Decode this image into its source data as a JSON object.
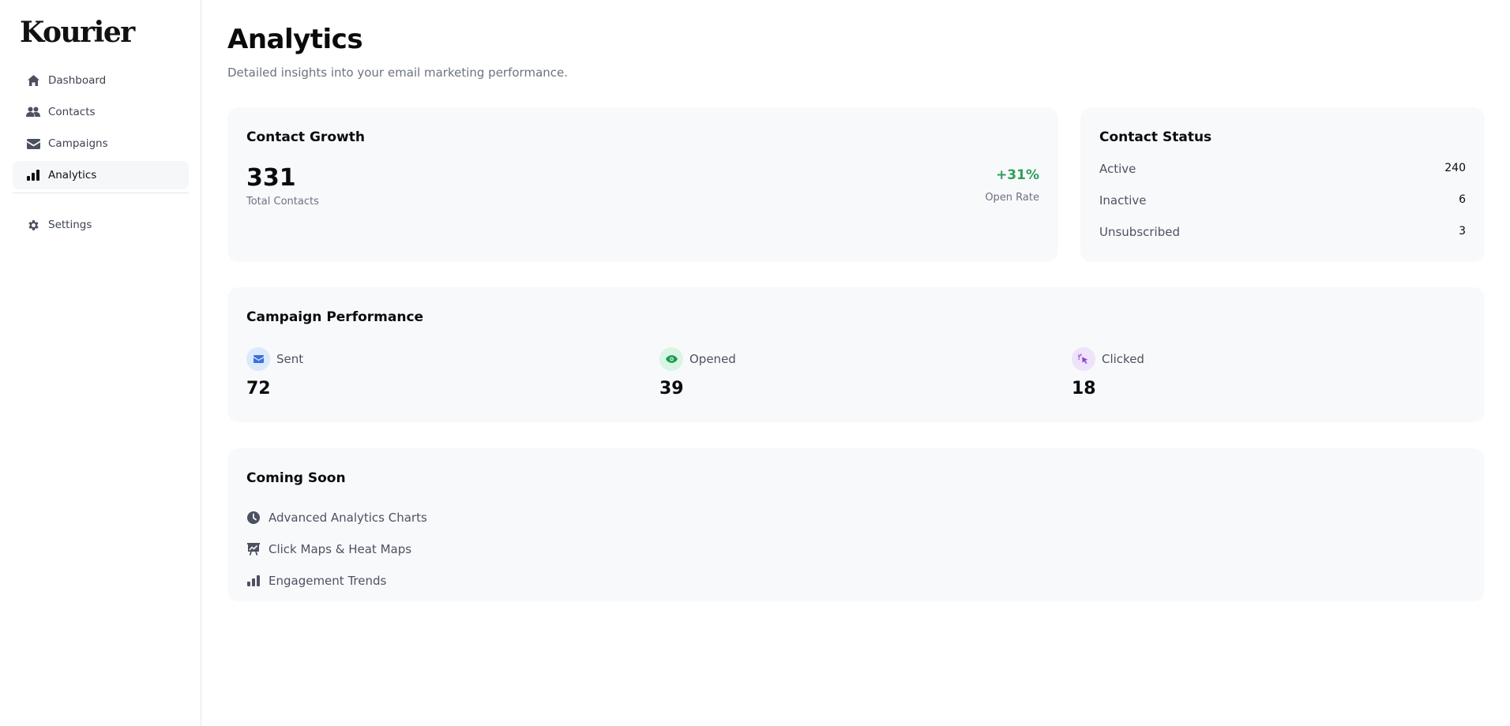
{
  "app": {
    "logo": "Kourier"
  },
  "sidebar": {
    "items": [
      {
        "label": "Dashboard",
        "icon": "home-icon",
        "active": false
      },
      {
        "label": "Contacts",
        "icon": "users-icon",
        "active": false
      },
      {
        "label": "Campaigns",
        "icon": "envelope-icon",
        "active": false
      },
      {
        "label": "Analytics",
        "icon": "bar-chart-icon",
        "active": true
      }
    ],
    "secondary": [
      {
        "label": "Settings",
        "icon": "gear-icon"
      }
    ]
  },
  "header": {
    "title": "Analytics",
    "subtitle": "Detailed insights into your email marketing performance."
  },
  "contact_growth": {
    "title": "Contact Growth",
    "total": "331",
    "total_label": "Total Contacts",
    "rate": "+31%",
    "rate_label": "Open Rate",
    "rate_color": "#2f9e5a"
  },
  "contact_status": {
    "title": "Contact Status",
    "rows": [
      {
        "label": "Active",
        "value": "240"
      },
      {
        "label": "Inactive",
        "value": "6"
      },
      {
        "label": "Unsubscribed",
        "value": "3"
      }
    ]
  },
  "campaign_performance": {
    "title": "Campaign Performance",
    "metrics": [
      {
        "label": "Sent",
        "value": "72",
        "icon": "envelope-icon",
        "color": "#3b6fe0",
        "bg": "#dce8fb"
      },
      {
        "label": "Opened",
        "value": "39",
        "icon": "eye-icon",
        "color": "#1f9a55",
        "bg": "#d9f5e3"
      },
      {
        "label": "Clicked",
        "value": "18",
        "icon": "cursor-click-icon",
        "color": "#8a3fd6",
        "bg": "#efe3fb"
      }
    ]
  },
  "coming_soon": {
    "title": "Coming Soon",
    "items": [
      {
        "label": "Advanced Analytics Charts",
        "icon": "clock-icon"
      },
      {
        "label": "Click Maps & Heat Maps",
        "icon": "presentation-chart-icon"
      },
      {
        "label": "Engagement Trends",
        "icon": "bar-chart-icon"
      }
    ]
  }
}
